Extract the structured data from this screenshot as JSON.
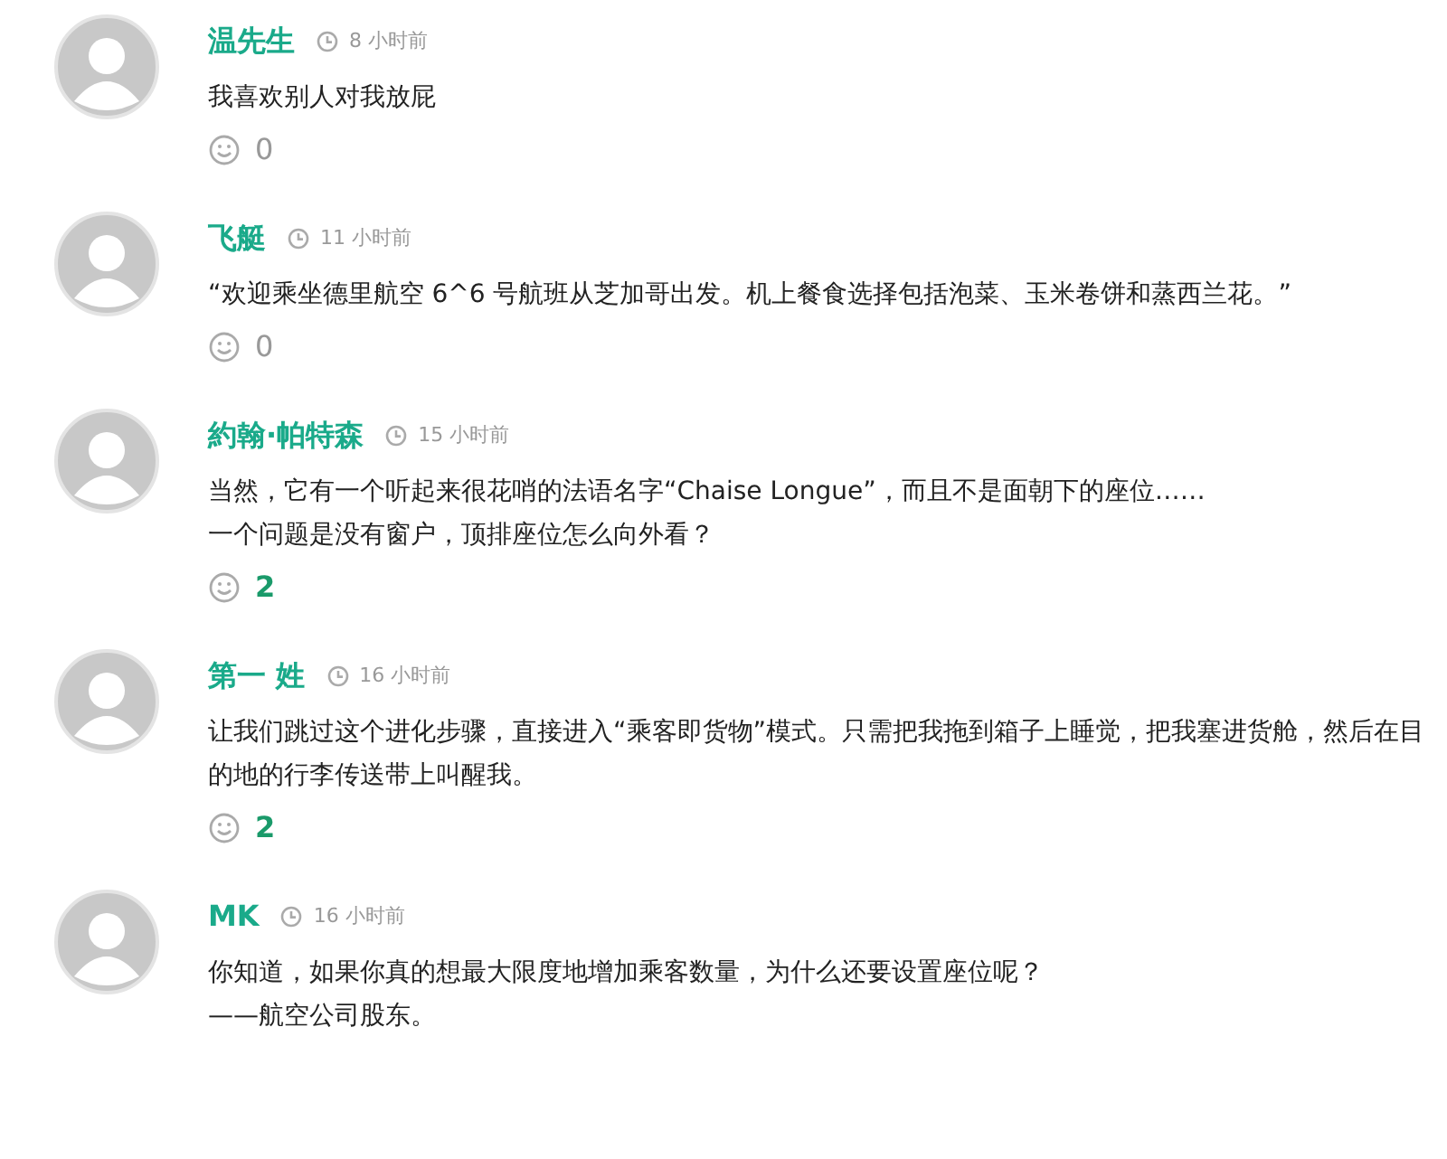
{
  "comments": [
    {
      "author": "温先生",
      "time": "8 小时前",
      "lines": [
        "我喜欢别人对我放屁"
      ],
      "reactions": {
        "count": "0",
        "active": false
      }
    },
    {
      "author": "飞艇",
      "time": "11 小时前",
      "lines": [
        "“欢迎乘坐德里航空 6^6 号航班从芝加哥出发。机上餐食选择包括泡菜、玉米卷饼和蒸西兰花。”"
      ],
      "reactions": {
        "count": "0",
        "active": false
      }
    },
    {
      "author": "約翰·帕特森",
      "time": "15 小时前",
      "lines": [
        "当然，它有一个听起来很花哨的法语名字“Chaise Longue”，而且不是面朝下的座位……",
        "一个问题是没有窗户，顶排座位怎么向外看？"
      ],
      "reactions": {
        "count": "2",
        "active": true
      }
    },
    {
      "author": "第一 姓",
      "time": "16 小时前",
      "lines": [
        "让我们跳过这个进化步骤，直接进入“乘客即货物”模式。只需把我拖到箱子上睡觉，把我塞进货舱，然后在目的地的行李传送带上叫醒我。"
      ],
      "reactions": {
        "count": "2",
        "active": true
      }
    },
    {
      "author": "MK",
      "time": "16 小时前",
      "lines": [
        "你知道，如果你真的想最大限度地增加乘客数量，为什么还要设置座位呢？",
        "——航空公司股东。"
      ]
    }
  ]
}
